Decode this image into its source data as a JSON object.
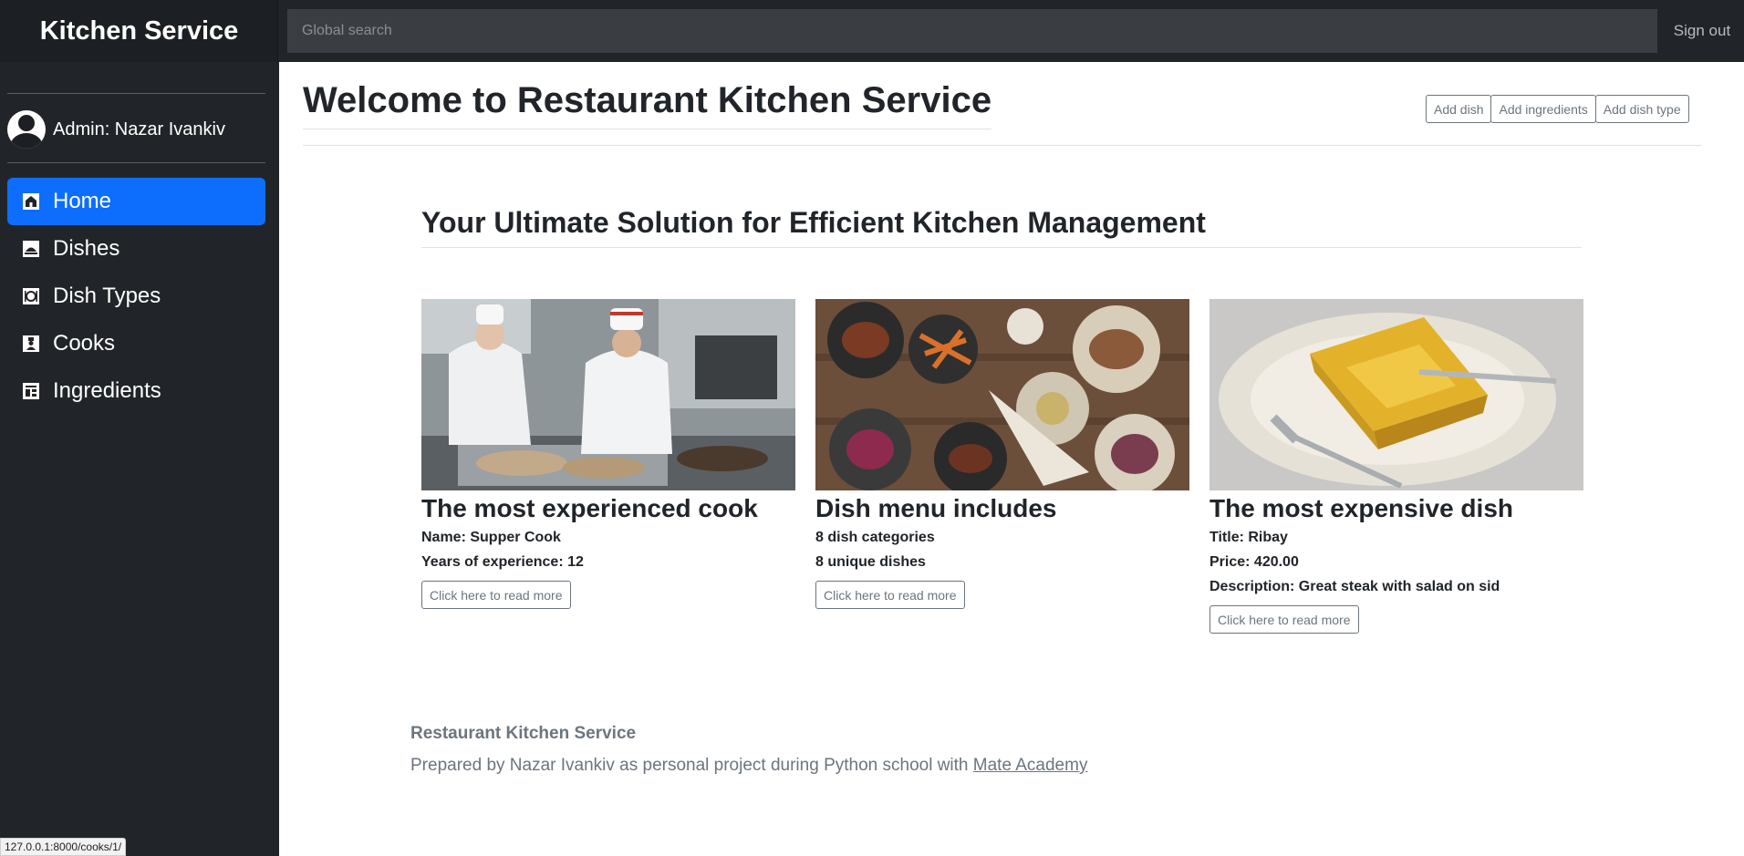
{
  "app": {
    "brand": "Kitchen Service"
  },
  "header": {
    "search_placeholder": "Global search",
    "sign_out": "Sign out"
  },
  "sidebar": {
    "user_label": "Admin: Nazar Ivankiv",
    "items": [
      {
        "label": "Home",
        "icon": "home-icon",
        "active": true
      },
      {
        "label": "Dishes",
        "icon": "dish-icon",
        "active": false
      },
      {
        "label": "Dish Types",
        "icon": "cutlery-icon",
        "active": false
      },
      {
        "label": "Cooks",
        "icon": "cook-icon",
        "active": false
      },
      {
        "label": "Ingredients",
        "icon": "ingredients-icon",
        "active": false
      }
    ]
  },
  "status_url": "127.0.0.1:8000/cooks/1/",
  "main": {
    "title": "Welcome to Restaurant Kitchen Service",
    "actions": [
      "Add dish",
      "Add ingredients",
      "Add dish type"
    ],
    "subtitle": "Your Ultimate Solution for Efficient Kitchen Management",
    "cards": [
      {
        "heading": "The most experienced cook",
        "lines": [
          "Name: Supper Cook",
          "Years of experience: 12"
        ],
        "button": "Click here to read more"
      },
      {
        "heading": "Dish menu includes",
        "lines": [
          "8 dish categories",
          "8 unique dishes"
        ],
        "button": "Click here to read more"
      },
      {
        "heading": "The most expensive dish",
        "lines": [
          "Title: Ribay",
          "Price: 420.00",
          "Description: Great steak with salad on sid"
        ],
        "button": "Click here to read more"
      }
    ]
  },
  "footer": {
    "title": "Restaurant Kitchen Service",
    "text": "Prepared by Nazar Ivankiv as personal project during Python school with",
    "link": "Mate Academy"
  },
  "colors": {
    "sidebar": "#212529",
    "accent": "#0d6efd",
    "muted": "#6c757d"
  }
}
